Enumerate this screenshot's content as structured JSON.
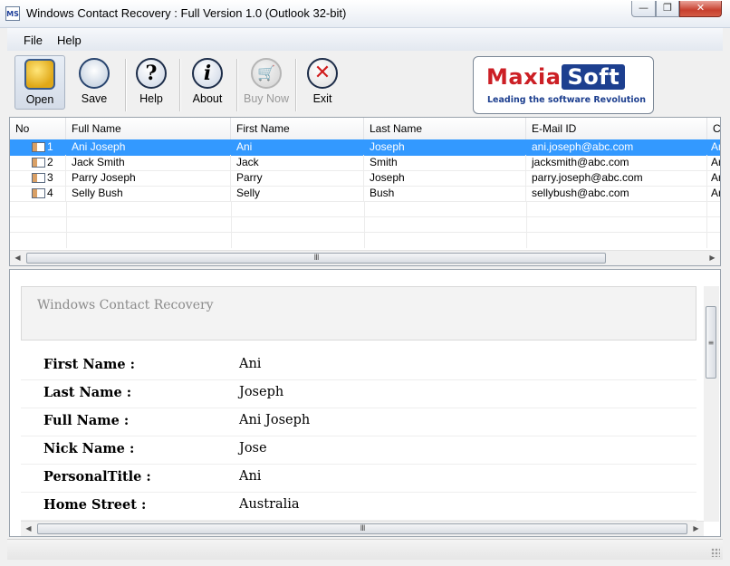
{
  "window": {
    "title": "Windows Contact Recovery : Full Version 1.0 (Outlook 32-bit)",
    "app_icon_text": "MS",
    "controls": {
      "minimize": "—",
      "maximize": "❐",
      "close": "✕"
    }
  },
  "menu": {
    "file": "File",
    "help": "Help"
  },
  "toolbar": {
    "open": {
      "label": "Open",
      "icon": "open-folder-icon"
    },
    "save": {
      "label": "Save",
      "icon": "save-disk-icon"
    },
    "help": {
      "label": "Help",
      "icon": "help-question-icon",
      "glyph": "?"
    },
    "about": {
      "label": "About",
      "icon": "info-icon",
      "glyph": "i"
    },
    "buynow": {
      "label": "Buy Now",
      "icon": "cart-icon",
      "glyph": "🛒"
    },
    "exit": {
      "label": "Exit",
      "icon": "close-x-icon",
      "glyph": "✕"
    }
  },
  "logo": {
    "part1": "Maxia",
    "part2": "Soft",
    "tagline": "Leading the software Revolution"
  },
  "grid": {
    "columns": [
      "No",
      "Full Name",
      "First Name",
      "Last Name",
      "E-Mail ID",
      "Co"
    ],
    "rows": [
      {
        "no": "1",
        "full_name": "Ani Joseph",
        "first_name": "Ani",
        "last_name": "Joseph",
        "email": "ani.joseph@abc.com",
        "co": "Ar",
        "selected": true
      },
      {
        "no": "2",
        "full_name": "Jack Smith",
        "first_name": "Jack",
        "last_name": "Smith",
        "email": "jacksmith@abc.com",
        "co": "Ar",
        "selected": false
      },
      {
        "no": "3",
        "full_name": "Parry Joseph",
        "first_name": "Parry",
        "last_name": "Joseph",
        "email": "parry.joseph@abc.com",
        "co": "Ar",
        "selected": false
      },
      {
        "no": "4",
        "full_name": "Selly Bush",
        "first_name": "Selly",
        "last_name": "Bush",
        "email": "sellybush@abc.com",
        "co": "Ar",
        "selected": false
      }
    ],
    "scroll_thumb_glyph": "III"
  },
  "detail": {
    "header_title": "Windows Contact Recovery",
    "fields": [
      {
        "label": "First Name :",
        "value": "Ani"
      },
      {
        "label": "Last Name :",
        "value": "Joseph"
      },
      {
        "label": "Full Name :",
        "value": "Ani Joseph"
      },
      {
        "label": "Nick Name :",
        "value": "Jose"
      },
      {
        "label": "PersonalTitle :",
        "value": "Ani"
      },
      {
        "label": "Home Street :",
        "value": "Australia"
      }
    ],
    "scroll_thumb_glyph": "III"
  },
  "colors": {
    "selection": "#3399ff",
    "brand_red": "#cc1f25",
    "brand_blue": "#1d3f8f"
  }
}
